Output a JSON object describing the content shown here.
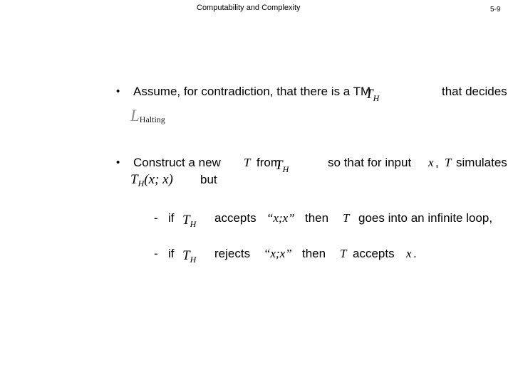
{
  "slide": {
    "header_title": "Computability and Complexity",
    "page_number": "5-9",
    "background_color": "#ffffff",
    "text_color": "#000000",
    "muted_color": "#8f8f8f"
  },
  "bullets": [
    {
      "marker": "•",
      "text_before": "Assume, for contradiction, that there is a TM",
      "text_after": "that decides",
      "math_overlay": "T",
      "math_overlay_sub": "H",
      "graphic": {
        "symbol": "L",
        "subscript": "Halting"
      }
    },
    {
      "marker": "•",
      "text_1": "Construct a new",
      "math_1": "T",
      "text_2": "from",
      "math_2": "T",
      "math_2_sub": "H",
      "text_3": "so that for input",
      "math_3": "x",
      "text_4": ",",
      "math_4": "T",
      "text_5": "simulates",
      "equation": "T",
      "equation_sub": "H",
      "equation_args": "(x; x)",
      "text_6": "but"
    }
  ],
  "subbullets": [
    {
      "marker": "-",
      "text_1": "if",
      "math_1": "T",
      "math_1_sub": "H",
      "text_2": "accepts",
      "quoted": "“x;x”",
      "text_3": "then",
      "math_2": "T",
      "text_4": "goes into an infinite loop,"
    },
    {
      "marker": "-",
      "text_1": "if",
      "math_1": "T",
      "math_1_sub": "H",
      "text_2": "rejects",
      "quoted": "“x;x”",
      "text_3": "then",
      "math_2": "T",
      "text_4": "accepts",
      "math_3": "x",
      "text_5": "."
    }
  ]
}
